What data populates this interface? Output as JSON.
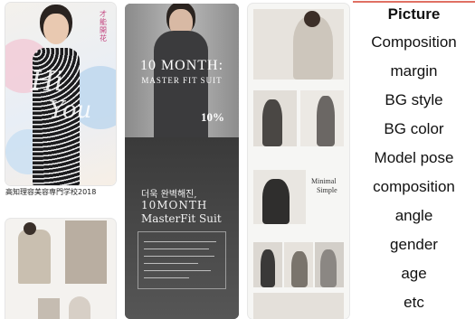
{
  "gallery": {
    "poster1": {
      "script_text": "Hi",
      "script_text2": "You",
      "vertical_text": "才能開花",
      "caption": "高知理容美容専門学校2018"
    },
    "fashion": {
      "title": "10 MONTH:",
      "subtitle": "MASTER FIT SUIT",
      "discount": "10%",
      "korean_line": "더욱 완벽해진,",
      "title2": "10MONTH",
      "subtitle2": "MasterFit Suit"
    },
    "lookbook": {
      "label1": "Minimal",
      "label2": "Simple"
    }
  },
  "criteria": {
    "items": [
      "Picture",
      "Composition",
      "margin",
      "BG style",
      "BG color",
      "Model pose",
      "composition",
      "angle",
      "gender",
      "age",
      "etc"
    ]
  },
  "colors": {
    "accent_line": "#e07063"
  }
}
